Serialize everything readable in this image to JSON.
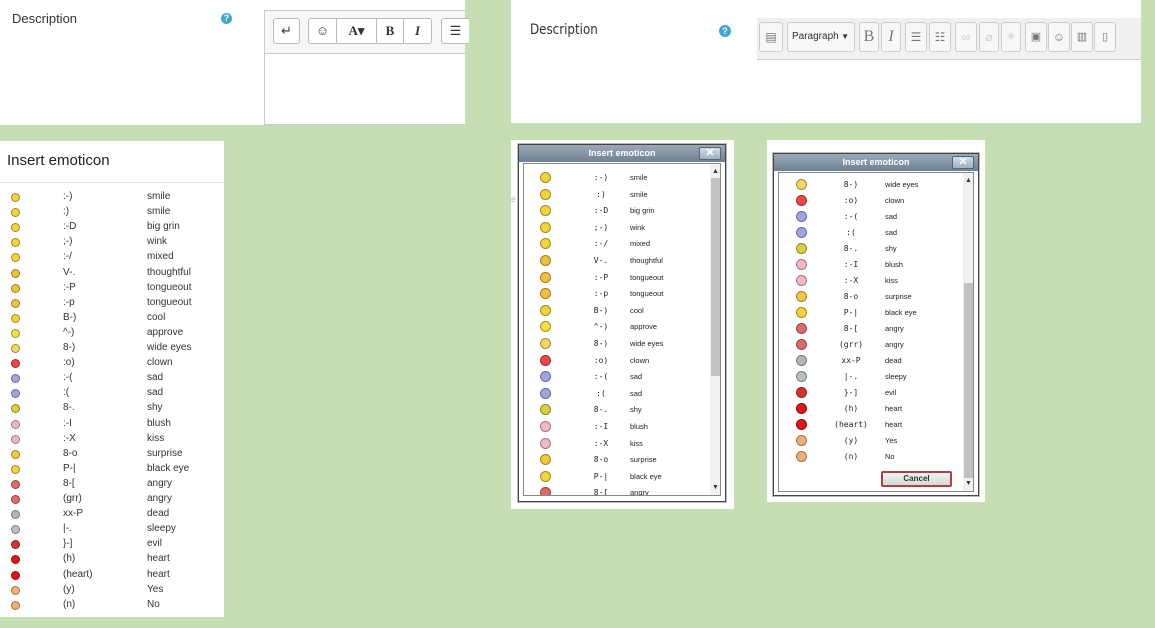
{
  "panel1": {
    "label": "Description",
    "help": "?",
    "toolbar": {
      "redo": "↵",
      "emoticon": "☺",
      "font": "A▾",
      "bold": "B",
      "italic": "I",
      "list": "☰"
    }
  },
  "panel2": {
    "label": "Description",
    "help": "?",
    "toolbar": {
      "paragraph": "Paragraph",
      "bold": "B",
      "italic": "I"
    }
  },
  "panel3": {
    "title": "Insert emoticon",
    "rows": [
      {
        "code": ":-)",
        "meaning": "smile",
        "color": "#f7d33a"
      },
      {
        "code": ":)",
        "meaning": "smile",
        "color": "#f7d33a"
      },
      {
        "code": ":-D",
        "meaning": "big grin",
        "color": "#f7d33a"
      },
      {
        "code": ";-)",
        "meaning": "wink",
        "color": "#f7d33a"
      },
      {
        "code": ":-/",
        "meaning": "mixed",
        "color": "#f7d33a"
      },
      {
        "code": "V-.",
        "meaning": "thoughtful",
        "color": "#e9c23a"
      },
      {
        "code": ":-P",
        "meaning": "tongueout",
        "color": "#f4c23a"
      },
      {
        "code": ":-p",
        "meaning": "tongueout",
        "color": "#f4c23a"
      },
      {
        "code": "B-)",
        "meaning": "cool",
        "color": "#f7d33a"
      },
      {
        "code": "^-)",
        "meaning": "approve",
        "color": "#f7e03a"
      },
      {
        "code": "8-)",
        "meaning": "wide eyes",
        "color": "#f0d860"
      },
      {
        "code": ":o)",
        "meaning": "clown",
        "color": "#f24545"
      },
      {
        "code": ":-(",
        "meaning": "sad",
        "color": "#9fa6e0"
      },
      {
        "code": ":(",
        "meaning": "sad",
        "color": "#9fa6e0"
      },
      {
        "code": "8-.",
        "meaning": "shy",
        "color": "#d8d040"
      },
      {
        "code": ":-I",
        "meaning": "blush",
        "color": "#f5b7c2"
      },
      {
        "code": ":-X",
        "meaning": "kiss",
        "color": "#f5b7c2"
      },
      {
        "code": "8-o",
        "meaning": "surprise",
        "color": "#f7c63a"
      },
      {
        "code": "P-|",
        "meaning": "black eye",
        "color": "#f7d33a"
      },
      {
        "code": "8-[",
        "meaning": "angry",
        "color": "#e06a6a"
      },
      {
        "code": "(grr)",
        "meaning": "angry",
        "color": "#e06a6a"
      },
      {
        "code": "xx-P",
        "meaning": "dead",
        "color": "#b5b5b5"
      },
      {
        "code": "|-.",
        "meaning": "sleepy",
        "color": "#b8c4b8"
      },
      {
        "code": "}-]",
        "meaning": "evil",
        "color": "#d93030"
      },
      {
        "code": "(h)",
        "meaning": "heart",
        "color": "#e01515"
      },
      {
        "code": "(heart)",
        "meaning": "heart",
        "color": "#e01515"
      },
      {
        "code": "(y)",
        "meaning": "Yes",
        "color": "#f0b070"
      },
      {
        "code": "(n)",
        "meaning": "No",
        "color": "#f0b070"
      }
    ]
  },
  "popup1": {
    "title": "Insert emoticon",
    "close": "✕",
    "rows": [
      {
        "code": ":-)",
        "meaning": "smile",
        "color": "#f7d33a"
      },
      {
        "code": ":)",
        "meaning": "smile",
        "color": "#f7d33a"
      },
      {
        "code": ":-D",
        "meaning": "big grin",
        "color": "#f7d33a"
      },
      {
        "code": ";-)",
        "meaning": "wink",
        "color": "#f7d33a"
      },
      {
        "code": ":-/",
        "meaning": "mixed",
        "color": "#f7d33a"
      },
      {
        "code": "V-.",
        "meaning": "thoughtful",
        "color": "#e9c23a"
      },
      {
        "code": ":-P",
        "meaning": "tongueout",
        "color": "#f4c23a"
      },
      {
        "code": ":-p",
        "meaning": "tongueout",
        "color": "#f4c23a"
      },
      {
        "code": "B-)",
        "meaning": "cool",
        "color": "#f7d33a"
      },
      {
        "code": "^-)",
        "meaning": "approve",
        "color": "#f7e03a"
      },
      {
        "code": "8-)",
        "meaning": "wide eyes",
        "color": "#f0d860"
      },
      {
        "code": ":o)",
        "meaning": "clown",
        "color": "#f24545"
      },
      {
        "code": ":-(",
        "meaning": "sad",
        "color": "#9fa6e0"
      },
      {
        "code": ":(",
        "meaning": "sad",
        "color": "#9fa6e0"
      },
      {
        "code": "8-.",
        "meaning": "shy",
        "color": "#d8d040"
      },
      {
        "code": ":-I",
        "meaning": "blush",
        "color": "#f5b7c2"
      },
      {
        "code": ":-X",
        "meaning": "kiss",
        "color": "#f5b7c2"
      },
      {
        "code": "8-o",
        "meaning": "surprise",
        "color": "#f7c63a"
      },
      {
        "code": "P-|",
        "meaning": "black eye",
        "color": "#f7d33a"
      },
      {
        "code": "8-[",
        "meaning": "angry",
        "color": "#e06a6a"
      }
    ]
  },
  "popup2": {
    "title": "Insert emoticon",
    "close": "✕",
    "cancel": "Cancel",
    "rows": [
      {
        "code": "8-)",
        "meaning": "wide eyes",
        "color": "#f0d860"
      },
      {
        "code": ":o)",
        "meaning": "clown",
        "color": "#f24545"
      },
      {
        "code": ":-(",
        "meaning": "sad",
        "color": "#9fa6e0"
      },
      {
        "code": ":(",
        "meaning": "sad",
        "color": "#9fa6e0"
      },
      {
        "code": "8-.",
        "meaning": "shy",
        "color": "#d8d040"
      },
      {
        "code": ":-I",
        "meaning": "blush",
        "color": "#f5b7c2"
      },
      {
        "code": ":-X",
        "meaning": "kiss",
        "color": "#f5b7c2"
      },
      {
        "code": "8-o",
        "meaning": "surprise",
        "color": "#f7c63a"
      },
      {
        "code": "P-|",
        "meaning": "black eye",
        "color": "#f7d33a"
      },
      {
        "code": "8-[",
        "meaning": "angry",
        "color": "#e06a6a"
      },
      {
        "code": "(grr)",
        "meaning": "angry",
        "color": "#e06a6a"
      },
      {
        "code": "xx-P",
        "meaning": "dead",
        "color": "#b5b5b5"
      },
      {
        "code": "|-.",
        "meaning": "sleepy",
        "color": "#b8c4b8"
      },
      {
        "code": "}-]",
        "meaning": "evil",
        "color": "#d93030"
      },
      {
        "code": "(h)",
        "meaning": "heart",
        "color": "#e01515"
      },
      {
        "code": "(heart)",
        "meaning": "heart",
        "color": "#e01515"
      },
      {
        "code": "(y)",
        "meaning": "Yes",
        "color": "#f0b070"
      },
      {
        "code": "(n)",
        "meaning": "No",
        "color": "#f0b070"
      }
    ]
  }
}
